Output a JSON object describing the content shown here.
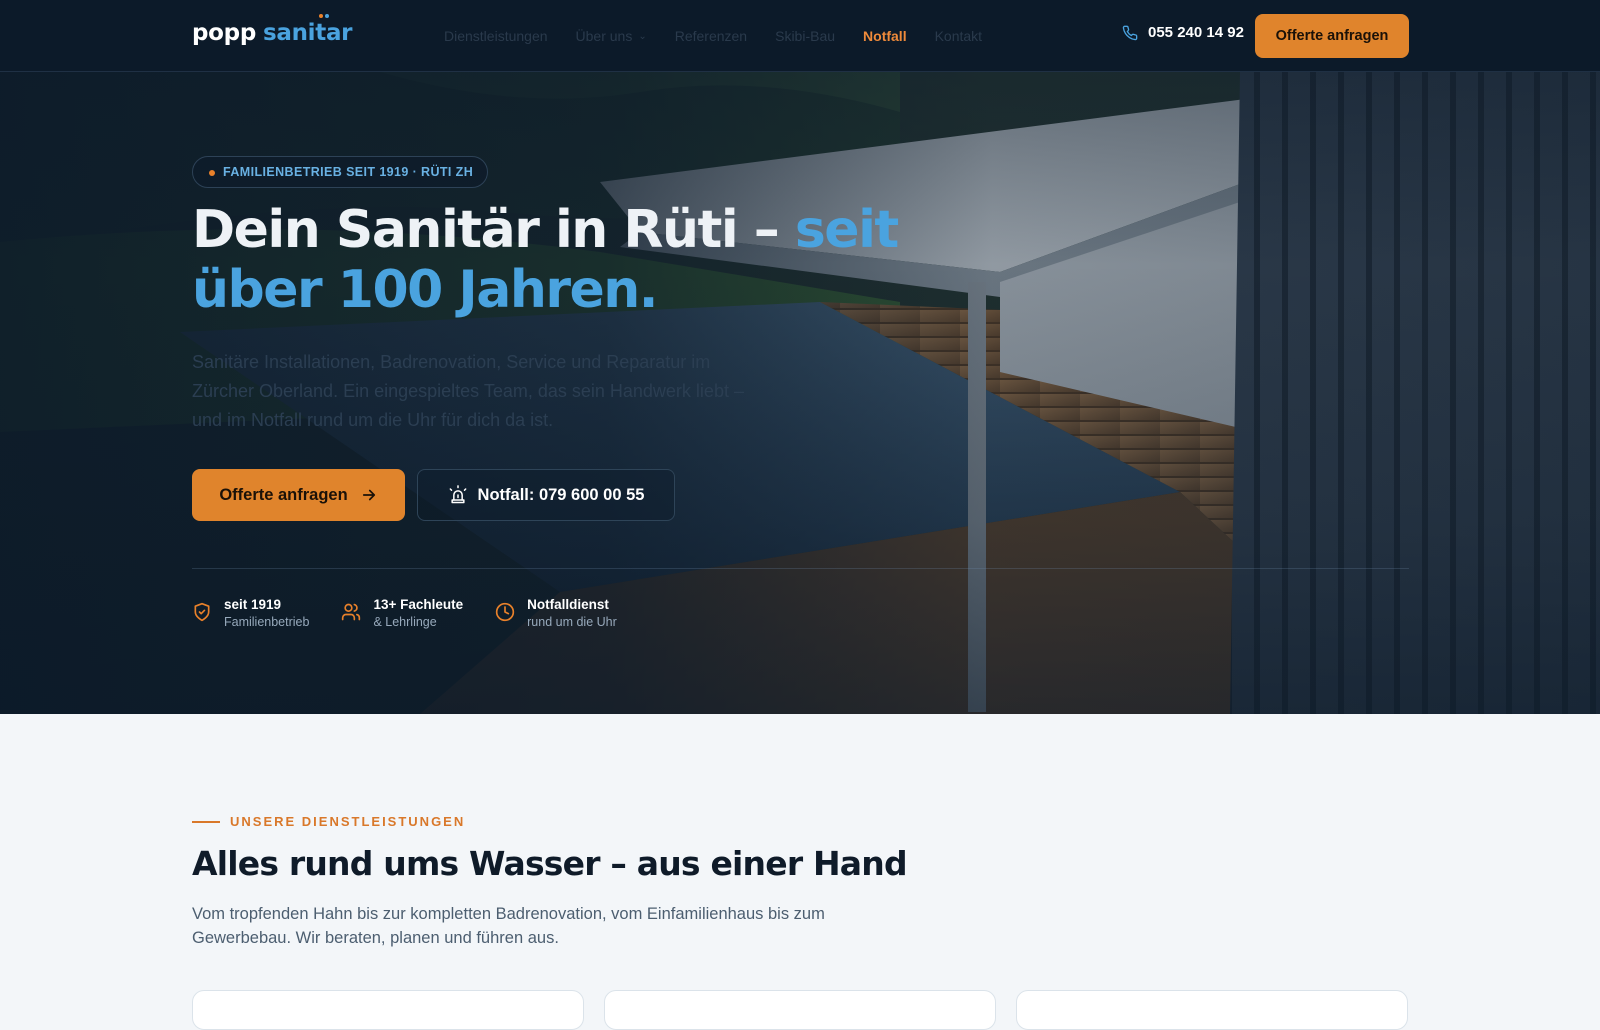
{
  "header": {
    "logo": {
      "word1": "popp",
      "word2": "sanitar"
    },
    "nav": [
      {
        "label": "Dienstleistungen"
      },
      {
        "label": "Über uns",
        "has_dropdown": true
      },
      {
        "label": "Referenzen"
      },
      {
        "label": "Skibi-Bau"
      },
      {
        "label": "Notfall",
        "active": true
      },
      {
        "label": "Kontakt"
      }
    ],
    "phone": "055 240 14 92",
    "cta": "Offerte anfragen"
  },
  "hero": {
    "badge": "FAMILIENBETRIEB SEIT 1919 · RÜTI ZH",
    "title_part1": "Dein Sanitär in Rüti – ",
    "title_accent": "seit über 100 Jahren.",
    "text": "Sanitäre Installationen, Badrenovation, Service und Reparatur im Zürcher Oberland. Ein eingespieltes Team, das sein Handwerk liebt – und im Notfall rund um die Uhr für dich da ist.",
    "primary_button": "Offerte anfragen",
    "emergency_button": "Notfall: 079 600 00 55",
    "stats": [
      {
        "icon": "shield-check-icon",
        "title": "seit 1919",
        "subtitle": "Familienbetrieb"
      },
      {
        "icon": "users-icon",
        "title": "13+ Fachleute",
        "subtitle": "& Lehrlinge"
      },
      {
        "icon": "clock-icon",
        "title": "Notfalldienst",
        "subtitle": "rund um die Uhr"
      }
    ]
  },
  "services": {
    "eyebrow": "UNSERE DIENSTLEISTUNGEN",
    "title": "Alles rund ums Wasser – aus einer Hand",
    "text": "Vom tropfenden Hahn bis zur kompletten Badrenovation, vom Einfamilienhaus bis zum Gewerbebau. Wir beraten, planen und führen aus."
  },
  "colors": {
    "navy": "#0c1a29",
    "accent_blue": "#4aa3df",
    "accent_orange": "#e0842c",
    "light_bg": "#f3f6f9"
  }
}
